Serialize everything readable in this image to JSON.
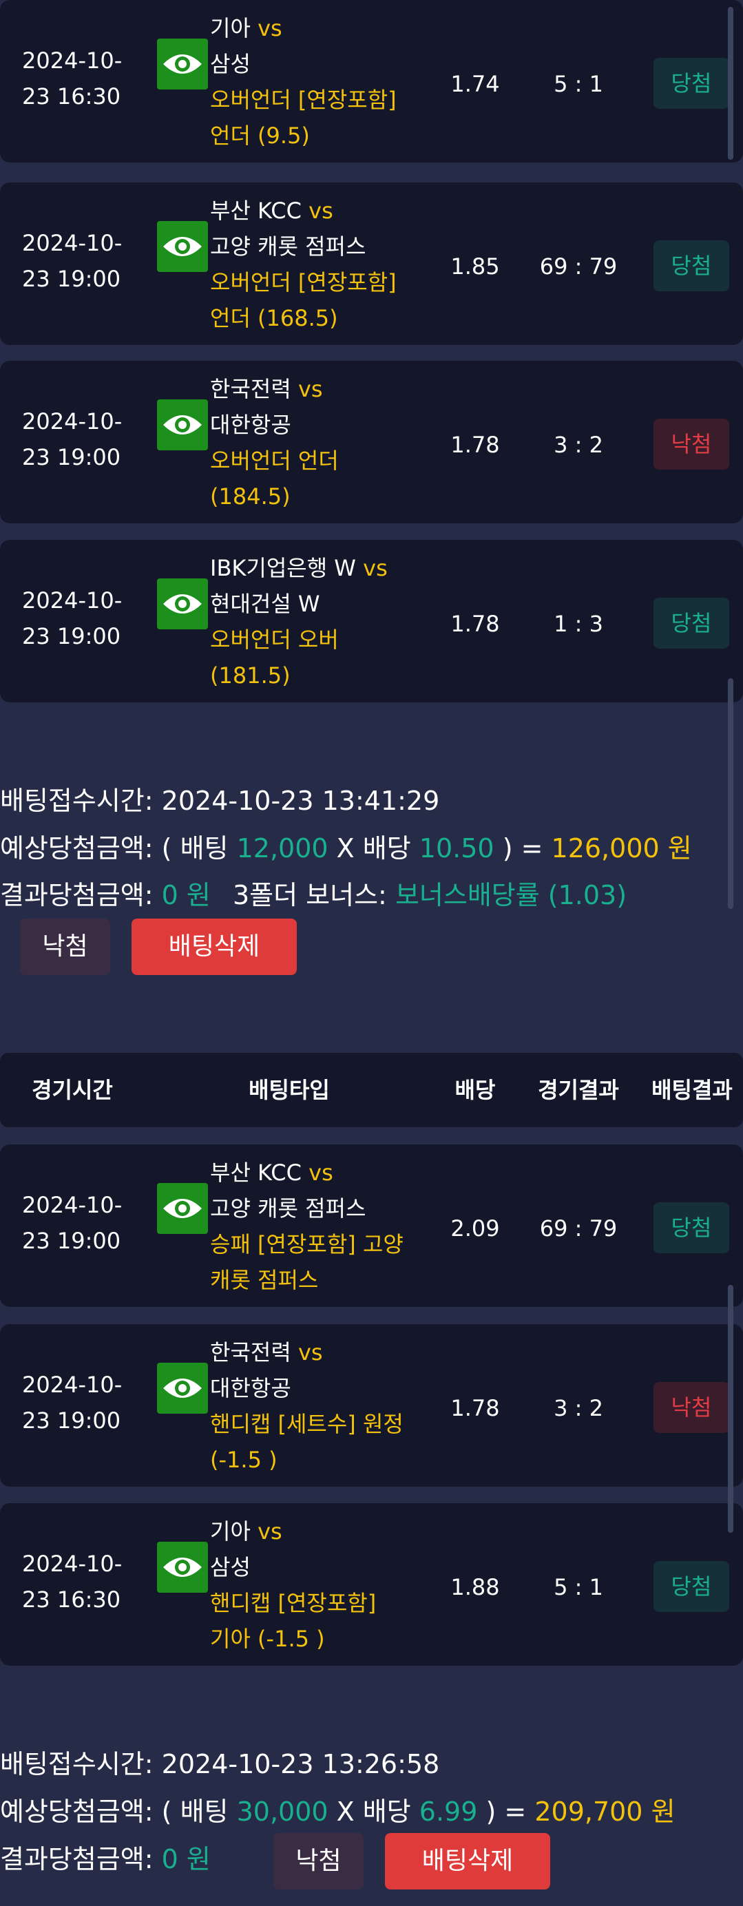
{
  "colors": {
    "accent_yellow": "#f4c20d",
    "accent_green": "#18b08e",
    "lose_red": "#e23d45",
    "eye_green": "#1c8f1c",
    "delete_red": "#df3b3b"
  },
  "vs_label": "vs",
  "bets": [
    {
      "time": [
        "2024-10-",
        "23 16:30"
      ],
      "team1": "기아",
      "team2": "삼성",
      "bet": [
        "오버언더 [연장포함]",
        "언더 (9.5)"
      ],
      "odds": "1.74",
      "score": "5 : 1",
      "result": "당첨",
      "status": "win"
    },
    {
      "time": [
        "2024-10-",
        "23 19:00"
      ],
      "team1": "부산 KCC",
      "team2": "고양 캐롯 점퍼스",
      "bet": [
        "오버언더 [연장포함]",
        "언더 (168.5)"
      ],
      "odds": "1.85",
      "score": "69 : 79",
      "result": "당첨",
      "status": "win"
    },
    {
      "time": [
        "2024-10-",
        "23 19:00"
      ],
      "team1": "한국전력",
      "team2": "대한항공",
      "bet": [
        "오버언더 언더",
        "(184.5)"
      ],
      "odds": "1.78",
      "score": "3 : 2",
      "result": "낙첨",
      "status": "lose"
    },
    {
      "time": [
        "2024-10-",
        "23 19:00"
      ],
      "team1": "IBK기업은행 W",
      "team2": "현대건설 W",
      "bet": [
        "오버언더 오버",
        "(181.5)"
      ],
      "odds": "1.78",
      "score": "1 : 3",
      "result": "당첨",
      "status": "win"
    }
  ],
  "summary1": {
    "receipt_label": "배팅접수시간:",
    "receipt_time": "2024-10-23 13:41:29",
    "expected_label": "예상당첨금액:",
    "open": "( 배팅",
    "stake": "12,000",
    "x_label": "X 배당",
    "odds": "10.50",
    "close": ") =",
    "payout": "126,000 원",
    "result_label": "결과당첨금액:",
    "result_amount": "0 원",
    "bonus_label": "3폴더 보너스:",
    "bonus_value": "보너스배당률 (1.03)",
    "status_button": "낙첨",
    "delete_button": "배팅삭제"
  },
  "table_header": {
    "col_time": "경기시간",
    "col_type": "배팅타입",
    "col_odds": "배당",
    "col_score": "경기결과",
    "col_result": "배팅결과"
  },
  "bets2": [
    {
      "time": [
        "2024-10-",
        "23 19:00"
      ],
      "team1": "부산 KCC",
      "team2": "고양 캐롯 점퍼스",
      "bet": [
        "승패 [연장포함] 고양",
        "캐롯 점퍼스"
      ],
      "odds": "2.09",
      "score": "69 : 79",
      "result": "당첨",
      "status": "win"
    },
    {
      "time": [
        "2024-10-",
        "23 19:00"
      ],
      "team1": "한국전력",
      "team2": "대한항공",
      "bet": [
        "핸디캡 [세트수] 원정",
        "(-1.5 )"
      ],
      "odds": "1.78",
      "score": "3 : 2",
      "result": "낙첨",
      "status": "lose"
    },
    {
      "time": [
        "2024-10-",
        "23 16:30"
      ],
      "team1": "기아",
      "team2": "삼성",
      "bet": [
        "핸디캡 [연장포함]",
        "기아 (-1.5 )"
      ],
      "odds": "1.88",
      "score": "5 : 1",
      "result": "당첨",
      "status": "win"
    }
  ],
  "summary2": {
    "receipt_label": "배팅접수시간:",
    "receipt_time": "2024-10-23 13:26:58",
    "expected_label": "예상당첨금액:",
    "open": "( 배팅",
    "stake": "30,000",
    "x_label": "X 배당",
    "odds": "6.99",
    "close": ") =",
    "payout": "209,700 원",
    "result_label": "결과당첨금액:",
    "result_amount": "0 원",
    "status_button": "낙첨",
    "delete_button": "배팅삭제"
  }
}
